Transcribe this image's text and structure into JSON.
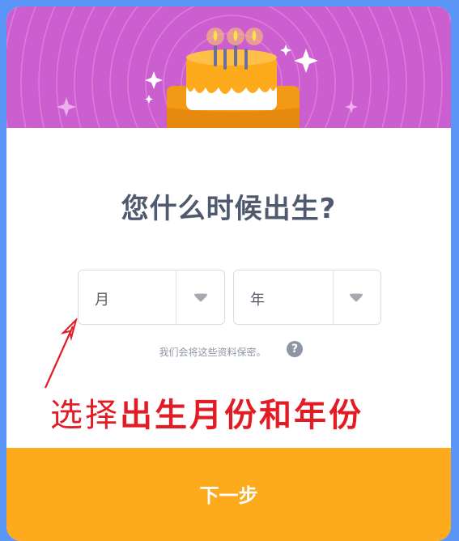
{
  "dialog": {
    "title": "您什么时候出生?",
    "month_select": {
      "value": "月"
    },
    "year_select": {
      "value": "年"
    },
    "privacy_note": "我们会将这些资料保密。",
    "help_symbol": "?",
    "next_button": "下一步"
  },
  "annotation": {
    "prefix": "选择",
    "emphasis": "出生月份和年份"
  },
  "colors": {
    "banner": "#cc5fcf",
    "button": "#fdaa1d",
    "annotation": "#e21b24",
    "title": "#505a6e"
  },
  "icons": [
    "birthday-cake-icon",
    "sparkle-icon",
    "chevron-down-icon",
    "help-icon",
    "arrow-icon"
  ]
}
